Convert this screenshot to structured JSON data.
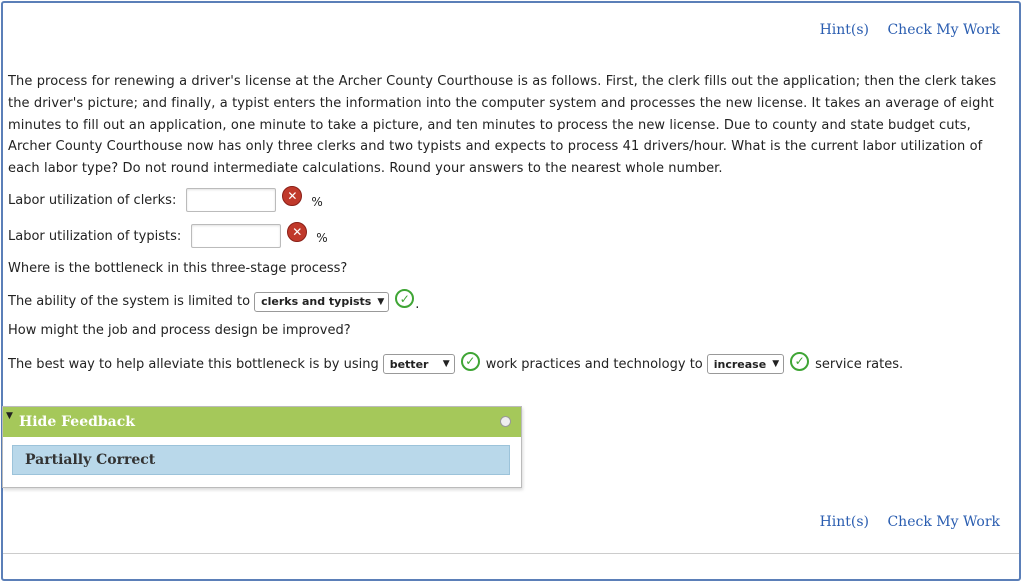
{
  "links": {
    "hints": "Hint(s)",
    "check_work": "Check My Work"
  },
  "question": "The process for renewing a driver's license at the Archer County Courthouse is as follows. First, the clerk fills out the application; then the clerk takes the driver's picture; and finally, a typist enters the information into the computer system and processes the new license. It takes an average of eight minutes to fill out an application, one minute to take a picture, and ten minutes to process the new license. Due to county and state budget cuts, Archer County Courthouse now has only three clerks and two typists and expects to process 41 drivers/hour. What is the current labor utilization of each labor type? Do not round intermediate calculations. Round your answers to the nearest whole number.",
  "clerks": {
    "label": "Labor utilization of clerks:",
    "value": "",
    "unit": "%"
  },
  "typists": {
    "label": "Labor utilization of typists:",
    "value": "",
    "unit": "%"
  },
  "bottleneck_question": "Where is the bottleneck in this three-stage process?",
  "limited": {
    "prefix": "The ability of the system is limited to",
    "selected": "clerks and typists",
    "suffix": "."
  },
  "improve_question": "How might the job and process design be improved?",
  "improve": {
    "prefix": "The best way to help alleviate this bottleneck is by using",
    "select1": "better",
    "middle": "work practices and technology to",
    "select2": "increase",
    "suffix": "service rates."
  },
  "feedback": {
    "header": "Hide Feedback",
    "status": "Partially Correct"
  },
  "colors": {
    "accent_green": "#a5c85a",
    "feedback_blue": "#b9d8ea",
    "link": "#2a5db0",
    "error_red": "#c0392b",
    "correct_green": "#3fa535"
  }
}
